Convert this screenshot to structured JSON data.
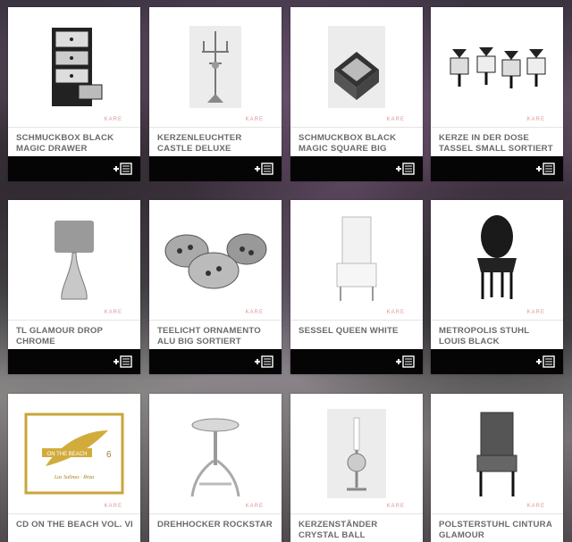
{
  "products": [
    {
      "title": "SCHMUCKBOX BLACK MAGIC DRAWER",
      "icon": "drawer-box-icon"
    },
    {
      "title": "KERZENLEUCHTER CASTLE DELUXE",
      "icon": "candelabra-icon"
    },
    {
      "title": "SCHMUCKBOX BLACK MAGIC SQUARE BIG",
      "icon": "square-box-icon"
    },
    {
      "title": "KERZE IN DER DOSE TASSEL SMALL SORTIERT",
      "icon": "tassel-boxes-icon"
    },
    {
      "title": "TL GLAMOUR DROP CHROME",
      "icon": "table-lamp-icon"
    },
    {
      "title": "TEELICHT ORNAMENTO ALU BIG SORTIERT",
      "icon": "tealight-bowls-icon"
    },
    {
      "title": "SESSEL QUEEN WHITE",
      "icon": "armchair-icon"
    },
    {
      "title": "METROPOLIS STUHL LOUIS BLACK",
      "icon": "chair-icon"
    },
    {
      "title": "CD ON THE BEACH VOL. VI",
      "icon": "cd-cover-icon",
      "cover_text": "ON THE BEACH",
      "cover_subtext": "Las Salinas · Ibiza",
      "cover_number": "6"
    },
    {
      "title": "DREHHOCKER ROCKSTAR",
      "icon": "stool-icon"
    },
    {
      "title": "KERZENSTÄNDER CRYSTAL BALL",
      "icon": "candle-holder-icon"
    },
    {
      "title": "POLSTERSTUHL CINTURA GLAMOUR",
      "icon": "upholstered-chair-icon"
    }
  ],
  "watermark": "KARE",
  "colors": {
    "action_bar": "#050505",
    "card": "#ffffff",
    "title": "#6a6a6a"
  }
}
